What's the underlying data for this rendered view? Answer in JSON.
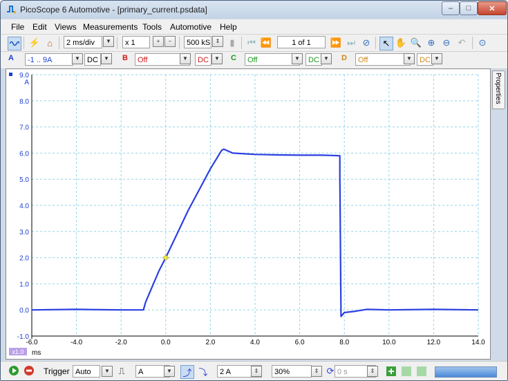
{
  "window": {
    "title": "PicoScope 6 Automotive - [primary_current.psdata]"
  },
  "menu": [
    "File",
    "Edit",
    "Views",
    "Measurements",
    "Tools",
    "Automotive",
    "Help"
  ],
  "toolbar1": {
    "timebase": "2 ms/div",
    "zoom": "x 1",
    "samples": "500 kS",
    "buffer": "1 of 1"
  },
  "channels": {
    "a": {
      "label": "A",
      "range": "-1 .. 9A",
      "coupling": "DC"
    },
    "b": {
      "label": "B",
      "range": "Off",
      "coupling": "DC"
    },
    "c": {
      "label": "C",
      "range": "Off",
      "coupling": "DC"
    },
    "d": {
      "label": "D",
      "range": "Off",
      "coupling": "DC"
    }
  },
  "side_tab": "Properties",
  "statusbar": {
    "trigger_label": "Trigger",
    "trigger_mode": "Auto",
    "trigger_channel": "A",
    "threshold": "2 A",
    "pretrigger": "30%",
    "delay": "0 s"
  },
  "chart_data": {
    "type": "line",
    "xlabel": "ms",
    "ylabel": "A",
    "xlim": [
      -6.0,
      14.0
    ],
    "ylim": [
      -1.0,
      9.0
    ],
    "x_ticks": [
      "-6.0",
      "-4.0",
      "-2.0",
      "0.0",
      "2.0",
      "4.0",
      "6.0",
      "8.0",
      "10.0",
      "12.0",
      "14.0"
    ],
    "y_ticks": [
      "-1.0",
      "0.0",
      "1.0",
      "2.0",
      "3.0",
      "4.0",
      "5.0",
      "6.0",
      "7.0",
      "8.0",
      "9.0"
    ],
    "x_scale_badge": "x1.0",
    "grid": true,
    "series": [
      {
        "color": "#2b3fe0",
        "x": [
          -6.0,
          -4.0,
          -2.0,
          -1.0,
          -0.9,
          -0.6,
          -0.3,
          0.0,
          0.5,
          1.0,
          1.5,
          2.0,
          2.5,
          2.6,
          3.0,
          4.0,
          5.0,
          6.0,
          7.0,
          7.8,
          7.8,
          7.85,
          8.0,
          8.5,
          9.0,
          10.0,
          12.0,
          14.0
        ],
        "y": [
          0.0,
          0.02,
          0.0,
          0.0,
          0.3,
          0.9,
          1.5,
          2.0,
          2.9,
          3.8,
          4.6,
          5.4,
          6.1,
          6.15,
          6.0,
          5.95,
          5.93,
          5.92,
          5.92,
          5.9,
          5.2,
          -0.25,
          -0.1,
          -0.05,
          0.02,
          0.0,
          0.02,
          0.0
        ]
      }
    ],
    "trigger_marker": {
      "x": 0.0,
      "y": 2.0,
      "color": "#f2e83a"
    }
  }
}
